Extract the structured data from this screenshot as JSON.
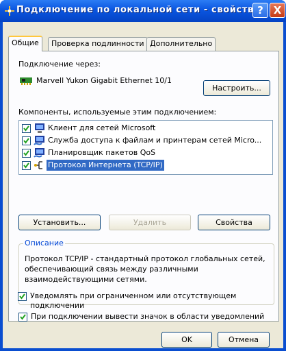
{
  "titlebar": {
    "title": "Подключение по локальной сети - свойства",
    "help_glyph": "?",
    "close_glyph": "X",
    "icon": "network-connection-icon"
  },
  "tabs": [
    {
      "label": "Общие"
    },
    {
      "label": "Проверка подлинности"
    },
    {
      "label": "Дополнительно"
    }
  ],
  "general": {
    "connect_using_label": "Подключение через:",
    "adapter_name": "Marvell Yukon Gigabit Ethernet 10/1",
    "configure_button": "Настроить...",
    "components_label": "Компоненты, используемые этим подключением:",
    "components": [
      {
        "label": "Клиент для сетей Microsoft",
        "checked": true,
        "icon": "network-client-icon"
      },
      {
        "label": "Служба доступа к файлам и принтерам сетей Micro...",
        "checked": true,
        "icon": "file-printer-sharing-icon"
      },
      {
        "label": "Планировщик пакетов QoS",
        "checked": true,
        "icon": "qos-scheduler-icon"
      },
      {
        "label": "Протокол Интернета (TCP/IP)",
        "checked": true,
        "selected": true,
        "icon": "protocol-icon"
      }
    ],
    "install_button": "Установить...",
    "remove_button": "Удалить",
    "properties_button": "Свойства",
    "description_title": "Описание",
    "description_text": "Протокол TCP/IP - стандартный протокол глобальных сетей, обеспечивающий связь между различными взаимодействующими сетями.",
    "show_icon_checkbox": {
      "label": "При подключении вывести значок в области уведомлений",
      "checked": true
    },
    "notify_checkbox": {
      "label": "Уведомлять при ограниченном или отсутствующем подключении",
      "checked": true
    }
  },
  "footer": {
    "ok_button": "OK",
    "cancel_button": "Отмена"
  },
  "colors": {
    "titlebar": "#0a55e0",
    "window_bg": "#ece9d8",
    "selection": "#316ac5",
    "group_title": "#0046d5"
  }
}
